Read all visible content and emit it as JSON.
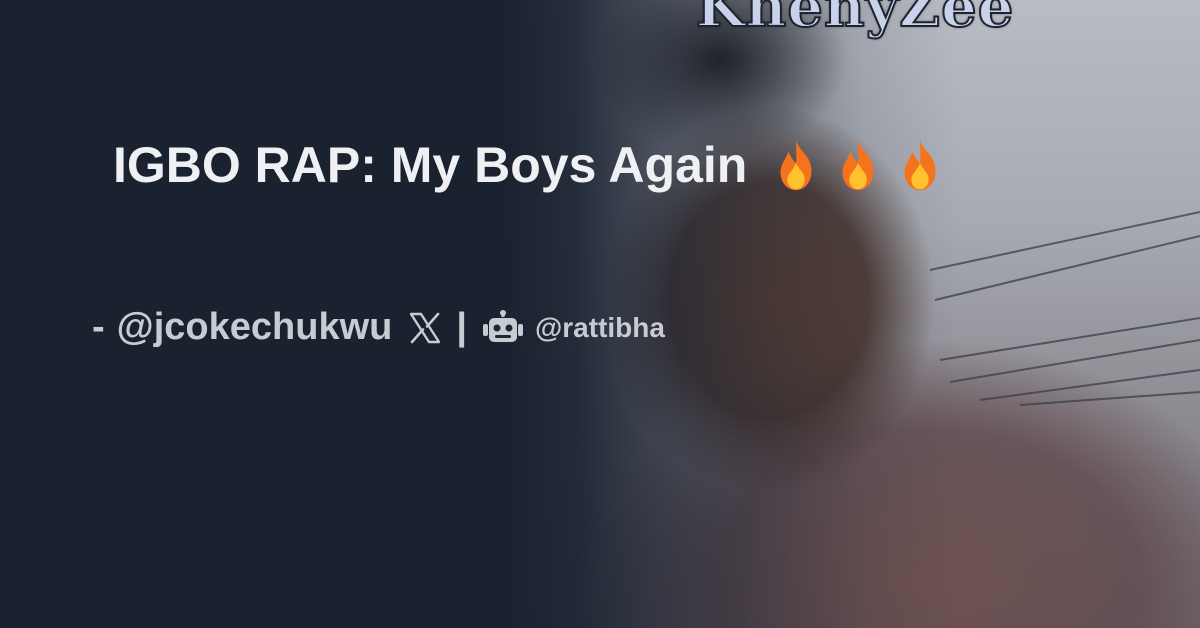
{
  "card": {
    "watermark": "KhenyZee",
    "title": "IGBO RAP: My Boys Again",
    "title_emoji": [
      "fire-icon",
      "fire-icon",
      "fire-icon"
    ],
    "byline": {
      "prefix": "-",
      "handle": "@jcokechukwu",
      "platform_icon": "x-logo-icon",
      "separator": "|",
      "bot_icon": "robot-icon",
      "site": "@rattibha"
    }
  },
  "colors": {
    "background": "#1a2230",
    "title_text": "#eef0f3",
    "byline_text": "#c7cbd2",
    "flame_orange": "#f5731d",
    "flame_yellow": "#ffc12e"
  }
}
